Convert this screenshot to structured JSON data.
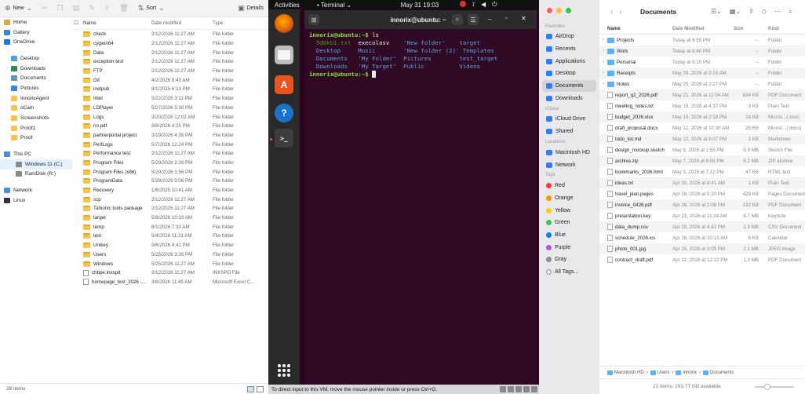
{
  "explorer": {
    "toolbar": {
      "new_label": "New",
      "sort_label": "Sort",
      "details_label": "Details"
    },
    "nav": [
      {
        "label": "Home",
        "color": "#e8a33d"
      },
      {
        "label": "Gallery",
        "color": "#3a86d6"
      },
      {
        "label": "OneDrive",
        "color": "#1a73e8"
      },
      {
        "label": "Desktop",
        "color": "#4aa3df"
      },
      {
        "label": "Downloads",
        "color": "#2e8b57"
      },
      {
        "label": "Documents",
        "color": "#6c8ebf"
      },
      {
        "label": "Pictures",
        "color": "#3a86d6"
      },
      {
        "label": "InnorixAgent",
        "color": "#f4c44e"
      },
      {
        "label": "oCam",
        "color": "#f4c44e"
      },
      {
        "label": "Screenshots",
        "color": "#f4c44e"
      },
      {
        "label": "Proof1",
        "color": "#f4c44e"
      },
      {
        "label": "Proof",
        "color": "#f4c44e"
      },
      {
        "label": "This PC",
        "color": "#4a90d9"
      },
      {
        "label": "Windows 11 (C:)",
        "color": "#888888"
      },
      {
        "label": "RamDisk (R:)",
        "color": "#888888"
      },
      {
        "label": "Network",
        "color": "#4a90d9"
      },
      {
        "label": "Linux",
        "color": "#333333"
      }
    ],
    "columns": {
      "name": "Name",
      "date": "Date modified",
      "type": "Type"
    },
    "rows": [
      {
        "name": "check",
        "date": "2/12/2026 11:27 AM",
        "type": "File folder",
        "kind": "folder"
      },
      {
        "name": "cygwin64",
        "date": "2/12/2026 11:27 AM",
        "type": "File folder",
        "kind": "folder"
      },
      {
        "name": "Data",
        "date": "2/12/2026 11:27 AM",
        "type": "File folder",
        "kind": "folder"
      },
      {
        "name": "exception test",
        "date": "2/12/2026 11:27 AM",
        "type": "File folder",
        "kind": "folder"
      },
      {
        "name": "FTP",
        "date": "2/12/2026 11:27 AM",
        "type": "File folder",
        "kind": "folder"
      },
      {
        "name": "Git",
        "date": "4/2/2026 9:43 AM",
        "type": "File folder",
        "kind": "folder"
      },
      {
        "name": "inetpub",
        "date": "8/1/2025 6:13 PM",
        "type": "File folder",
        "kind": "folder"
      },
      {
        "name": "Intel",
        "date": "5/22/2026 3:11 PM",
        "type": "File folder",
        "kind": "folder"
      },
      {
        "name": "LDPlayer",
        "date": "5/27/2026 5:30 PM",
        "type": "File folder",
        "kind": "folder"
      },
      {
        "name": "Logs",
        "date": "3/20/2026 12:02 AM",
        "type": "File folder",
        "kind": "folder"
      },
      {
        "name": "no pdf",
        "date": "3/6/2026 4:25 PM",
        "type": "File folder",
        "kind": "folder"
      },
      {
        "name": "partnerportal project",
        "date": "3/19/2026 4:35 PM",
        "type": "File folder",
        "kind": "folder"
      },
      {
        "name": "PerfLogs",
        "date": "5/7/2026 12:24 PM",
        "type": "File folder",
        "kind": "folder"
      },
      {
        "name": "Performance test",
        "date": "2/12/2026 11:27 AM",
        "type": "File folder",
        "kind": "folder"
      },
      {
        "name": "Program Files",
        "date": "5/29/2026 2:26 PM",
        "type": "File folder",
        "kind": "folder"
      },
      {
        "name": "Program Files (x86)",
        "date": "5/29/2026 1:56 PM",
        "type": "File folder",
        "kind": "folder"
      },
      {
        "name": "ProgramData",
        "date": "5/28/2026 5:06 PM",
        "type": "File folder",
        "kind": "folder"
      },
      {
        "name": "Recovery",
        "date": "1/6/2025 10:41 AM",
        "type": "File folder",
        "kind": "folder"
      },
      {
        "name": "scp",
        "date": "2/12/2026 11:27 AM",
        "type": "File folder",
        "kind": "folder"
      },
      {
        "name": "Tahionic tools package",
        "date": "2/12/2026 11:27 AM",
        "type": "File folder",
        "kind": "folder"
      },
      {
        "name": "target",
        "date": "5/8/2026 10:33 AM",
        "type": "File folder",
        "kind": "folder"
      },
      {
        "name": "temp",
        "date": "6/1/2026 7:33 AM",
        "type": "File folder",
        "kind": "folder"
      },
      {
        "name": "test",
        "date": "5/4/2026 11:21 AM",
        "type": "File folder",
        "kind": "folder"
      },
      {
        "name": "Unikey",
        "date": "3/6/2026 4:41 PM",
        "type": "File folder",
        "kind": "folder"
      },
      {
        "name": "Users",
        "date": "5/25/2026 3:35 PM",
        "type": "File folder",
        "kind": "folder"
      },
      {
        "name": "Windows",
        "date": "5/25/2026 11:27 AM",
        "type": "File folder",
        "kind": "folder"
      },
      {
        "name": "chbpe.inxspd",
        "date": "2/12/2026 11:27 AM",
        "type": "INXSPD File",
        "kind": "file"
      },
      {
        "name": "homepage_text_2026 -...",
        "date": "3/6/2026 11:45 AM",
        "type": "Microsoft Excel C...",
        "kind": "file"
      }
    ],
    "status": "28 items"
  },
  "ubuntu": {
    "topbar": {
      "activities": "Activities",
      "app": "Terminal",
      "clock": "May 31  19:03"
    },
    "terminal_title": "innorix@ubuntu: ~",
    "prompt": "innorix@ubuntu:~$",
    "command": "ls",
    "ls": {
      "col1": [
        "5@0kb1.txt",
        "Desktop",
        "Documents",
        "Downloads"
      ],
      "col2": [
        "execolasv",
        "Music",
        "'My Folder'",
        "'My Target'"
      ],
      "col3": [
        "'New folder'",
        "'New folder (2)'",
        "Pictures",
        "Public"
      ],
      "col4": [
        "target",
        "Templates",
        "test_target",
        "Videos"
      ]
    },
    "vm_status": "To direct input to this VM, move the mouse pointer inside or press Ctrl+G."
  },
  "finder": {
    "title": "Documents",
    "sidebar": {
      "favorites_label": "Favorites",
      "favorites": [
        "AirDrop",
        "Recents",
        "Applications",
        "Desktop",
        "Documents",
        "Downloads"
      ],
      "icloud_label": "iCloud",
      "icloud": [
        "iCloud Drive",
        "Shared"
      ],
      "locations_label": "Locations",
      "locations": [
        "Macintosh HD",
        "Network"
      ],
      "tags_label": "Tags",
      "tags": [
        {
          "label": "Red",
          "color": "#ff3b30"
        },
        {
          "label": "Orange",
          "color": "#ff9500"
        },
        {
          "label": "Yellow",
          "color": "#ffcc00"
        },
        {
          "label": "Green",
          "color": "#34c759"
        },
        {
          "label": "Blue",
          "color": "#007aff"
        },
        {
          "label": "Purple",
          "color": "#af52de"
        },
        {
          "label": "Gray",
          "color": "#8e8e93"
        },
        {
          "label": "All Tags...",
          "color": ""
        }
      ]
    },
    "columns": {
      "name": "Name",
      "date": "Date Modified",
      "size": "Size",
      "kind": "Kind"
    },
    "rows": [
      {
        "name": "Projects",
        "date": "Today at 6:55 PM",
        "size": "--",
        "kind": "Folder",
        "type": "folder"
      },
      {
        "name": "Work",
        "date": "Today at 6:40 PM",
        "size": "--",
        "kind": "Folder",
        "type": "folder"
      },
      {
        "name": "Personal",
        "date": "Today at 6:10 PM",
        "size": "--",
        "kind": "Folder",
        "type": "folder"
      },
      {
        "name": "Receipts",
        "date": "May 28, 2026 at 9:15 AM",
        "size": "--",
        "kind": "Folder",
        "type": "folder"
      },
      {
        "name": "Notes",
        "date": "May 25, 2026 at 2:27 PM",
        "size": "--",
        "kind": "Folder",
        "type": "folder"
      },
      {
        "name": "report_q2_2026.pdf",
        "date": "May 21, 2026 at 11:04 AM",
        "size": "834 KB",
        "kind": "PDF Document",
        "type": "file"
      },
      {
        "name": "meeting_notes.txt",
        "date": "May 19, 2026 at 4:37 PM",
        "size": "3 KB",
        "kind": "Plain Text",
        "type": "file"
      },
      {
        "name": "budget_2026.xlsx",
        "date": "May 15, 2026 at 2:18 PM",
        "size": "18 KB",
        "kind": "Micros...(.xlsx)",
        "type": "file"
      },
      {
        "name": "draft_proposal.docx",
        "date": "May 12, 2026 at 10:30 AM",
        "size": "25 KB",
        "kind": "Micros...(.docx)",
        "type": "file"
      },
      {
        "name": "todo_list.md",
        "date": "May 12, 2026 at 8:07 PM",
        "size": "2 KB",
        "kind": "Markdown",
        "type": "file"
      },
      {
        "name": "design_mockup.sketch",
        "date": "May 9, 2026 at 1:55 PM",
        "size": "5.9 MB",
        "kind": "Sketch File",
        "type": "file"
      },
      {
        "name": "archive.zip",
        "date": "May 7, 2026 at 6:05 PM",
        "size": "5.2 MB",
        "kind": "ZIP archive",
        "type": "file"
      },
      {
        "name": "bookmarks_2026.html",
        "date": "May 3, 2026 at 7:12 PM",
        "size": "47 KB",
        "kind": "HTML text",
        "type": "file"
      },
      {
        "name": "ideas.txt",
        "date": "Apr 30, 2026 at 9:41 AM",
        "size": "1 KB",
        "kind": "Plain Text",
        "type": "file"
      },
      {
        "name": "travel_plan.pages",
        "date": "Apr 28, 2026 at 5:20 PM",
        "size": "429 KB",
        "kind": "Pages Document",
        "type": "file"
      },
      {
        "name": "invoice_0426.pdf",
        "date": "Apr 26, 2026 at 2:08 PM",
        "size": "192 KB",
        "kind": "PDF Document",
        "type": "file"
      },
      {
        "name": "presentation.key",
        "date": "Apr 23, 2026 at 11:34 AM",
        "size": "6.7 MB",
        "kind": "Keynote",
        "type": "file"
      },
      {
        "name": "data_dump.csv",
        "date": "Apr 20, 2026 at 4:42 PM",
        "size": "2.3 MB",
        "kind": "CSV Document",
        "type": "file"
      },
      {
        "name": "schedule_2026.ics",
        "date": "Apr 18, 2026 at 10:13 AM",
        "size": "6 KB",
        "kind": "Calendar",
        "type": "file"
      },
      {
        "name": "photo_001.jpg",
        "date": "Apr 15, 2026 at 3:05 PM",
        "size": "2.1 MB",
        "kind": "JPEG image",
        "type": "file"
      },
      {
        "name": "contract_draft.pdf",
        "date": "Apr 12, 2026 at 12:22 PM",
        "size": "1.3 MB",
        "kind": "PDF Document",
        "type": "file"
      }
    ],
    "path": [
      "Macintosh HD",
      "Users",
      "innorix",
      "Documents"
    ],
    "status": "21 items, 293.77 GB available"
  }
}
